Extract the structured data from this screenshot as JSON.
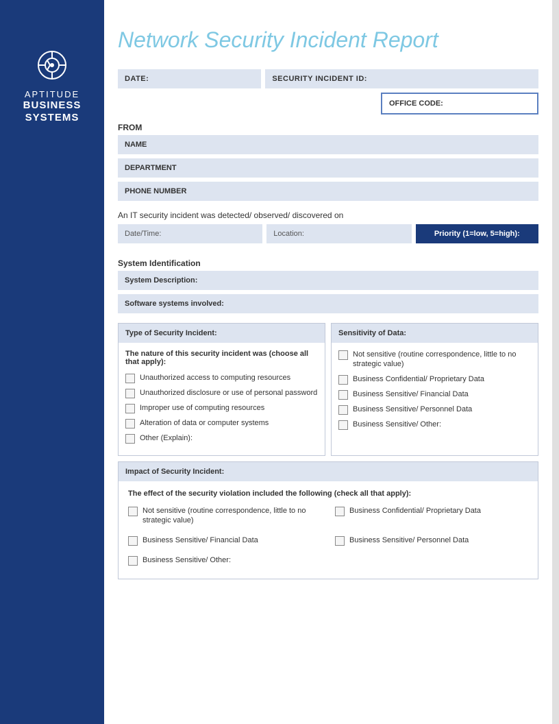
{
  "sidebar": {
    "brand_top": "APTITUDE",
    "brand_line1": "BUSINESS",
    "brand_line2": "SYSTEMS"
  },
  "header": {
    "title": "Network Security Incident Report"
  },
  "form": {
    "date_label": "DATE:",
    "incident_id_label": "SECURITY INCIDENT ID:",
    "office_code_label": "OFFICE CODE:",
    "from_label": "FROM",
    "name_label": "NAME",
    "department_label": "DEPARTMENT",
    "phone_label": "PHONE NUMBER",
    "detected_text": "An IT security incident was detected/ observed/ discovered on",
    "date_time_label": "Date/Time:",
    "location_label": "Location:",
    "priority_label": "Priority (1=low, 5=high):",
    "system_identification_heading": "System Identification",
    "system_description_label": "System Description:",
    "software_systems_label": "Software systems involved:"
  },
  "type_panel": {
    "header": "Type of Security Incident:",
    "subtext": "The nature of this security incident was (choose all that apply):",
    "items": [
      "Unauthorized access to computing resources",
      "Unauthorized disclosure or use of personal password",
      "Improper use of computing resources",
      "Alteration of data or computer systems",
      "Other (Explain):"
    ]
  },
  "sensitivity_panel": {
    "header": "Sensitivity of Data:",
    "items": [
      "Not sensitive (routine correspondence, little to no strategic value)",
      "Business Confidential/ Proprietary Data",
      "Business Sensitive/ Financial Data",
      "Business Sensitive/ Personnel Data",
      "Business Sensitive/ Other:"
    ]
  },
  "impact_section": {
    "header": "Impact of Security Incident:",
    "subtext": "The effect of the security violation included the following (check all that apply):",
    "items": [
      "Not sensitive (routine correspondence, little to no strategic value)",
      "Business Confidential/ Proprietary Data",
      "Business Sensitive/ Financial Data",
      "Business Sensitive/ Personnel Data",
      "Business Sensitive/ Other:"
    ]
  }
}
